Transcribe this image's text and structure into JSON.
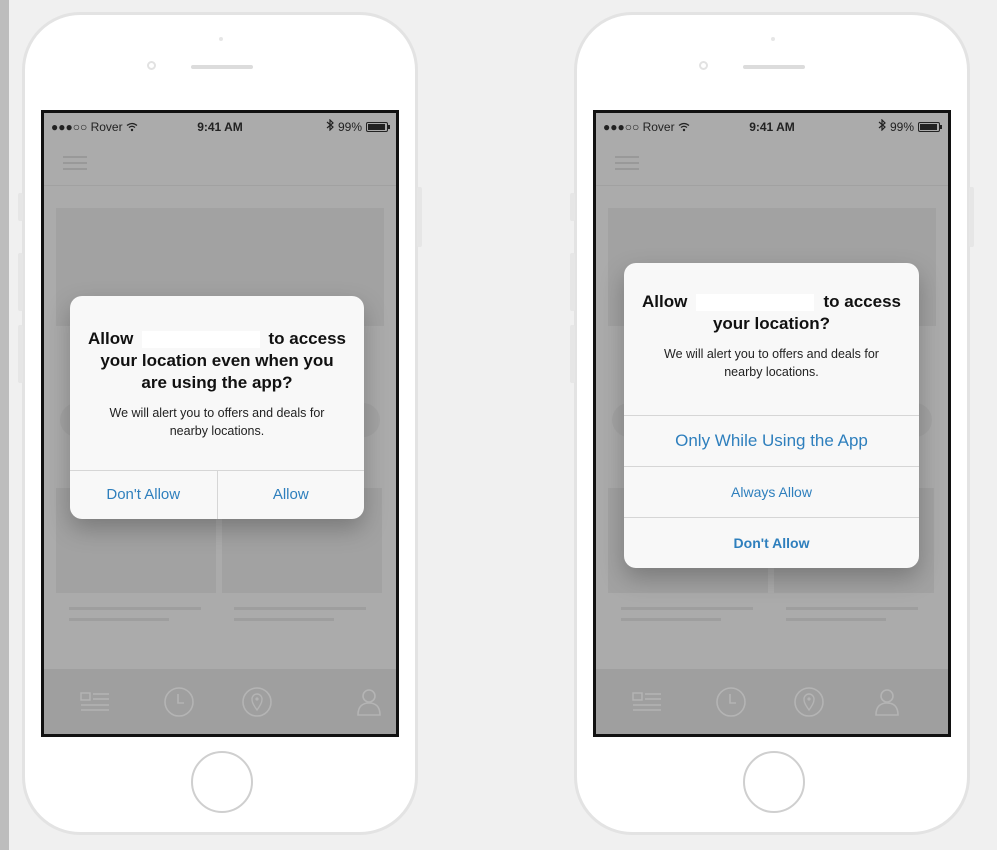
{
  "status_bar": {
    "carrier": "●●●○○ Rover",
    "wifi_icon": "wifi-icon",
    "time": "9:41 AM",
    "bluetooth_icon": "bluetooth-icon",
    "battery": "99%"
  },
  "alert_left": {
    "title_prefix": "Allow",
    "title_suffix": "to access",
    "title_rest": "your location even when you are using the app?",
    "message": "We will alert you to offers and deals for nearby locations.",
    "buttons": [
      "Don't Allow",
      "Allow"
    ]
  },
  "alert_right": {
    "title_prefix": "Allow",
    "title_suffix": "to access",
    "title_rest": "your location?",
    "message": "We will alert you to offers and deals for nearby locations.",
    "buttons": [
      "Only While Using the App",
      "Always Allow",
      "Don't Allow"
    ]
  },
  "tab_icons": [
    "list-icon",
    "clock-icon",
    "location-pin-icon",
    "profile-icon"
  ],
  "colors": {
    "accent": "#2e7fbd",
    "dim_overlay": "#ababab",
    "alert_bg": "#f8f8f8"
  }
}
